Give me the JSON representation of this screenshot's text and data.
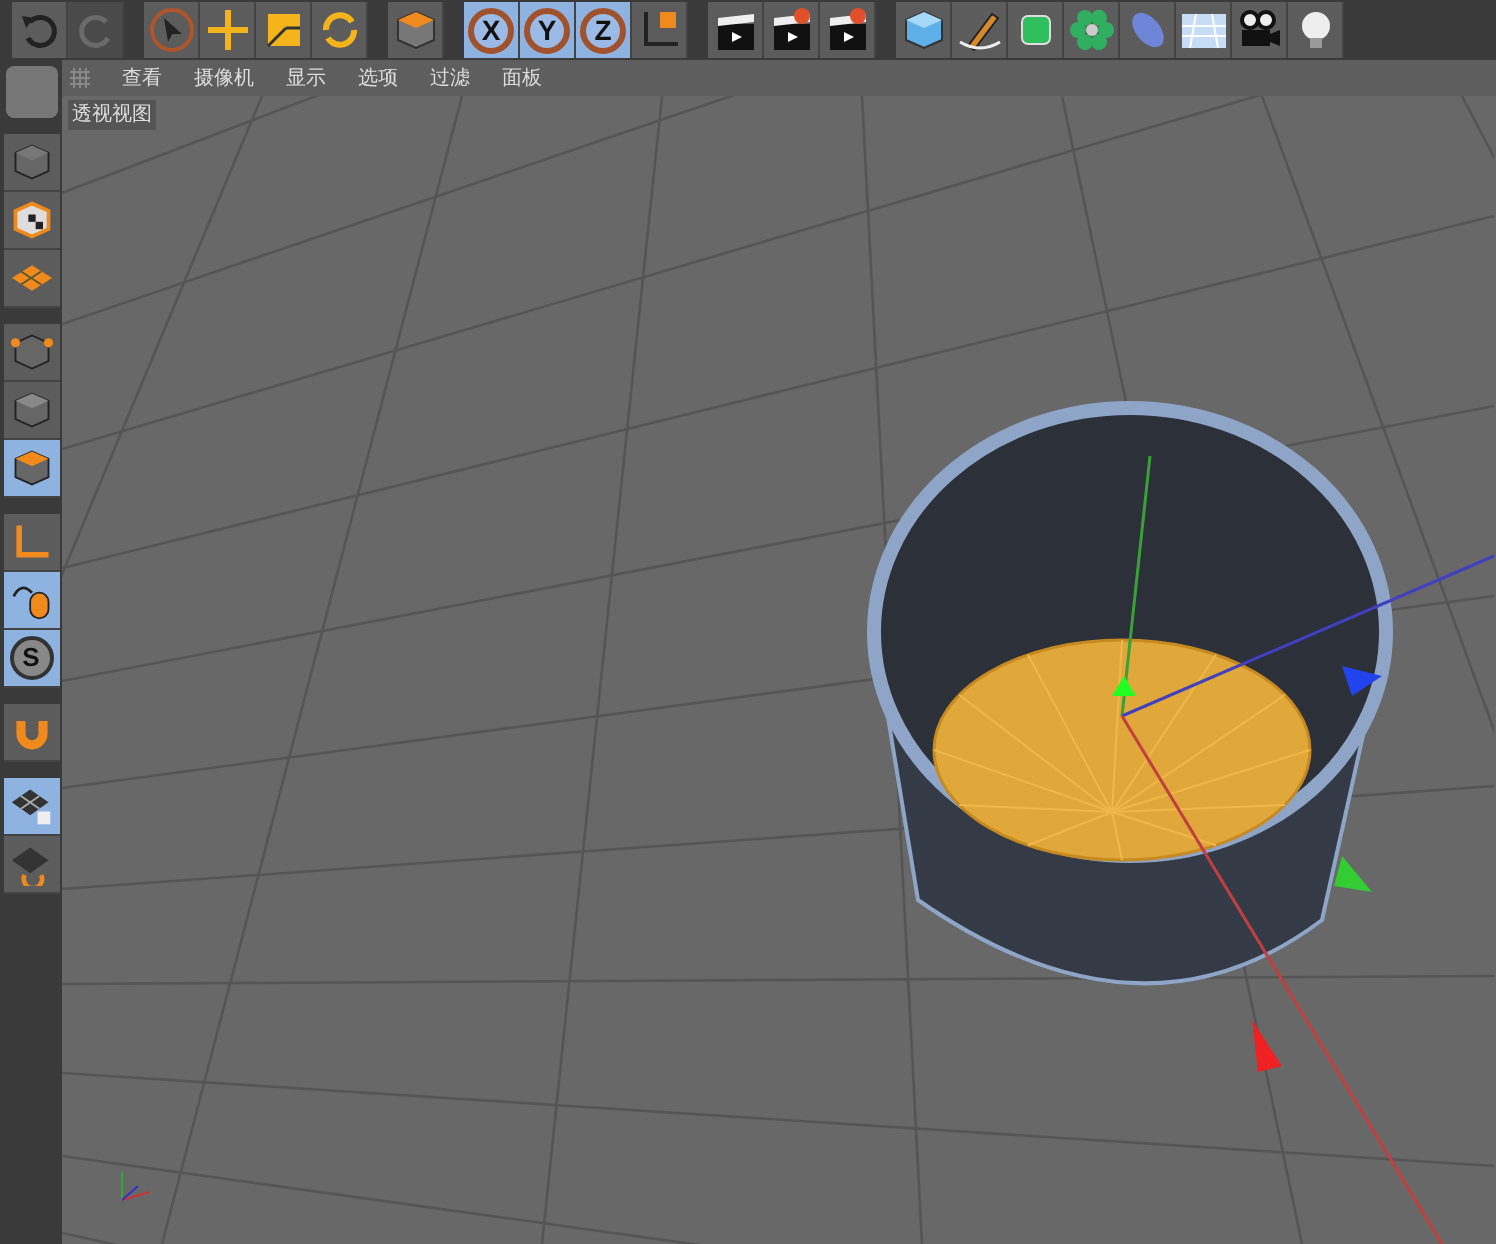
{
  "toolbar": {
    "groups": [
      [
        {
          "kind": "undo",
          "selected": false,
          "disabled": false
        },
        {
          "kind": "redo",
          "selected": false,
          "disabled": true
        }
      ],
      [
        {
          "kind": "select",
          "selected": false,
          "disabled": false
        },
        {
          "kind": "move",
          "selected": false,
          "disabled": false
        },
        {
          "kind": "scale",
          "selected": false,
          "disabled": false
        },
        {
          "kind": "rotate",
          "selected": false,
          "disabled": false
        }
      ],
      [
        {
          "kind": "object",
          "selected": false,
          "disabled": false
        }
      ],
      [
        {
          "kind": "axis",
          "label": "X",
          "selected": true,
          "disabled": false
        },
        {
          "kind": "axis",
          "label": "Y",
          "selected": true,
          "disabled": false
        },
        {
          "kind": "axis",
          "label": "Z",
          "selected": true,
          "disabled": false
        },
        {
          "kind": "coords",
          "selected": false,
          "disabled": false
        }
      ],
      [
        {
          "kind": "render",
          "selected": false,
          "disabled": false
        },
        {
          "kind": "render-view",
          "selected": false,
          "disabled": false
        },
        {
          "kind": "render-settings",
          "selected": false,
          "disabled": false
        }
      ],
      [
        {
          "kind": "cube",
          "selected": false,
          "disabled": false
        },
        {
          "kind": "pen",
          "selected": false,
          "disabled": false
        },
        {
          "kind": "subdivide",
          "selected": false,
          "disabled": false
        },
        {
          "kind": "cloner",
          "selected": false,
          "disabled": false
        },
        {
          "kind": "deformer",
          "selected": false,
          "disabled": false
        },
        {
          "kind": "floor",
          "selected": false,
          "disabled": false
        },
        {
          "kind": "camera",
          "selected": false,
          "disabled": false
        },
        {
          "kind": "light",
          "selected": false,
          "disabled": false
        }
      ]
    ]
  },
  "menu": [
    "查看",
    "摄像机",
    "显示",
    "选项",
    "过滤",
    "面板"
  ],
  "sidebar": {
    "groups": [
      [
        {
          "kind": "model",
          "selected": false
        },
        {
          "kind": "texture",
          "selected": false
        },
        {
          "kind": "workplane",
          "selected": false
        }
      ],
      [
        {
          "kind": "points",
          "selected": false
        },
        {
          "kind": "edges",
          "selected": false
        },
        {
          "kind": "polygons",
          "selected": true
        }
      ],
      [
        {
          "kind": "axis-mode",
          "selected": false
        },
        {
          "kind": "tweak",
          "selected": true
        },
        {
          "kind": "snap",
          "label": "S",
          "selected": true
        }
      ],
      [
        {
          "kind": "magnet",
          "selected": false
        }
      ],
      [
        {
          "kind": "lock-plane",
          "selected": true
        },
        {
          "kind": "plane-rotate",
          "selected": false
        }
      ]
    ]
  },
  "viewport": {
    "title": "透视视图"
  }
}
